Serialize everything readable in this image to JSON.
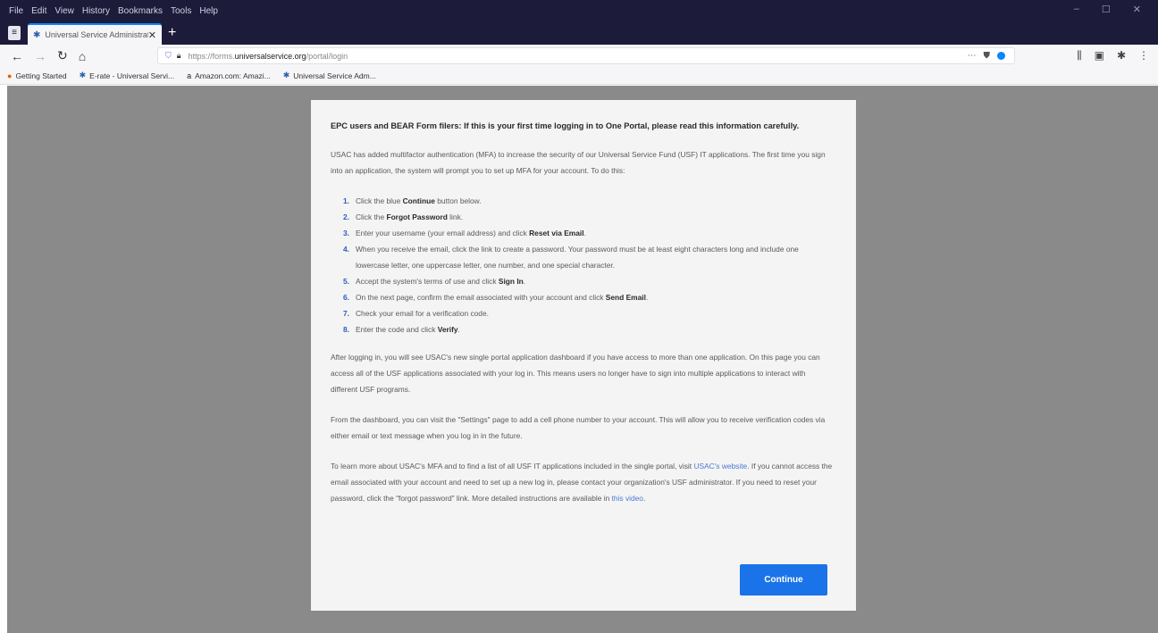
{
  "menubar": {
    "items": [
      "File",
      "Edit",
      "View",
      "History",
      "Bookmarks",
      "Tools",
      "Help"
    ]
  },
  "tab": {
    "title": "Universal Service Administrat..."
  },
  "urlbar": {
    "prefix": "https://forms.",
    "domain": "universalservice.org",
    "path": "/portal/login"
  },
  "bookmarks": [
    {
      "label": "Getting Started",
      "icon": "firefox-icon"
    },
    {
      "label": "E-rate - Universal Servi...",
      "icon": "usac-icon"
    },
    {
      "label": "Amazon.com: Amazi...",
      "icon": "amazon-icon"
    },
    {
      "label": "Universal Service Adm...",
      "icon": "usac-icon"
    }
  ],
  "modal": {
    "heading": "EPC users and BEAR Form filers: If this is your first time logging in to One Portal, please read this information carefully.",
    "intro": "USAC has added multifactor authentication (MFA) to increase the security of our Universal Service Fund (USF) IT applications. The first time you sign into an application, the system will prompt you to set up MFA for your account. To do this:",
    "steps": [
      {
        "num": "1.",
        "pre": "Click the blue ",
        "bold": "Continue",
        "post": " button below."
      },
      {
        "num": "2.",
        "pre": "Click the ",
        "bold": "Forgot Password",
        "post": " link."
      },
      {
        "num": "3.",
        "pre": "Enter your username (your email address) and click ",
        "bold": "Reset via Email",
        "post": "."
      },
      {
        "num": "4.",
        "pre": "When you receive the email, click the link to create a password. Your password must be at least eight characters long and include one lowercase letter, one uppercase letter, one number, and one special character.",
        "bold": "",
        "post": ""
      },
      {
        "num": "5.",
        "pre": "Accept the system's terms of use and click ",
        "bold": "Sign In",
        "post": "."
      },
      {
        "num": "6.",
        "pre": "On the next page, confirm the email associated with your account and click ",
        "bold": "Send Email",
        "post": "."
      },
      {
        "num": "7.",
        "pre": "Check your email for a verification code.",
        "bold": "",
        "post": ""
      },
      {
        "num": "8.",
        "pre": "Enter the code and click ",
        "bold": "Verify",
        "post": "."
      }
    ],
    "para2": "After logging in, you will see USAC's new single portal application dashboard if you have access to more than one application. On this page you can access all of the USF applications associated with your log in. This means users no longer have to sign into multiple applications to interact with different USF programs.",
    "para3": "From the dashboard, you can visit the \"Settings\" page to add a cell phone number to your account. This will allow you to receive verification codes via either email or text message when you log in in the future.",
    "para4_a": "To learn more about USAC's MFA and to find a list of all USF IT applications included in the single portal, visit ",
    "para4_link1": "USAC's website",
    "para4_b": ". If you cannot access the email associated with your account and need to set up a new log in, please contact your organization's USF administrator. If you need to reset your password, click the \"forgot password\" link. More detailed instructions are available in ",
    "para4_link2": "this video",
    "para4_c": ".",
    "continue_label": "Continue"
  }
}
